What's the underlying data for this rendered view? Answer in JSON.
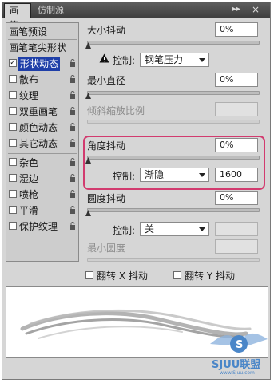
{
  "tabs": [
    "画笔",
    "仿制源"
  ],
  "window_controls": {
    "collapse": "▸▸",
    "close": "×"
  },
  "sidebar": {
    "preset_label": "画笔预设",
    "tip_shape_label": "画笔笔尖形状",
    "items": [
      {
        "label": "形状动态",
        "checked": true,
        "selected": true,
        "lock": true
      },
      {
        "label": "散布",
        "checked": false,
        "selected": false,
        "lock": true
      },
      {
        "label": "纹理",
        "checked": false,
        "selected": false,
        "lock": true
      },
      {
        "label": "双重画笔",
        "checked": false,
        "selected": false,
        "lock": true
      },
      {
        "label": "颜色动态",
        "checked": false,
        "selected": false,
        "lock": true
      },
      {
        "label": "其它动态",
        "checked": false,
        "selected": false,
        "lock": true
      },
      {
        "label": "杂色",
        "checked": false,
        "selected": false,
        "lock": true
      },
      {
        "label": "湿边",
        "checked": false,
        "selected": false,
        "lock": true
      },
      {
        "label": "喷枪",
        "checked": false,
        "selected": false,
        "lock": true
      },
      {
        "label": "平滑",
        "checked": false,
        "selected": false,
        "lock": true
      },
      {
        "label": "保护纹理",
        "checked": false,
        "selected": false,
        "lock": true
      }
    ]
  },
  "main": {
    "size_jitter": {
      "label": "大小抖动",
      "value": "0%",
      "slider_level": 0
    },
    "control_1": {
      "label": "控制:",
      "value": "钢笔压力",
      "warning_icon": "warning-icon"
    },
    "min_diameter": {
      "label": "最小直径",
      "value": "0%",
      "slider_level": 0
    },
    "tilt_scale": {
      "label": "倾斜缩放比例",
      "value": ""
    },
    "angle_jitter": {
      "label": "角度抖动",
      "value": "0%",
      "slider_level": 0
    },
    "control_2": {
      "label": "控制:",
      "value": "渐隐",
      "fade_steps": "1600"
    },
    "roundness_jitter": {
      "label": "圆度抖动",
      "value": "0%",
      "slider_level": 0
    },
    "control_3": {
      "label": "控制:",
      "value": "关"
    },
    "min_roundness": {
      "label": "最小圆度",
      "value": ""
    },
    "flip_x": {
      "label": "翻转 X 抖动",
      "checked": false
    },
    "flip_y": {
      "label": "翻转 Y 抖动",
      "checked": false
    }
  },
  "watermark": {
    "text": "SJUU联盟",
    "url": "www.Sjuu.com"
  },
  "colors": {
    "highlight": "#d23b6f",
    "selected_bg": "#1f3fa8",
    "panel_bg": "#d6d6d6"
  }
}
